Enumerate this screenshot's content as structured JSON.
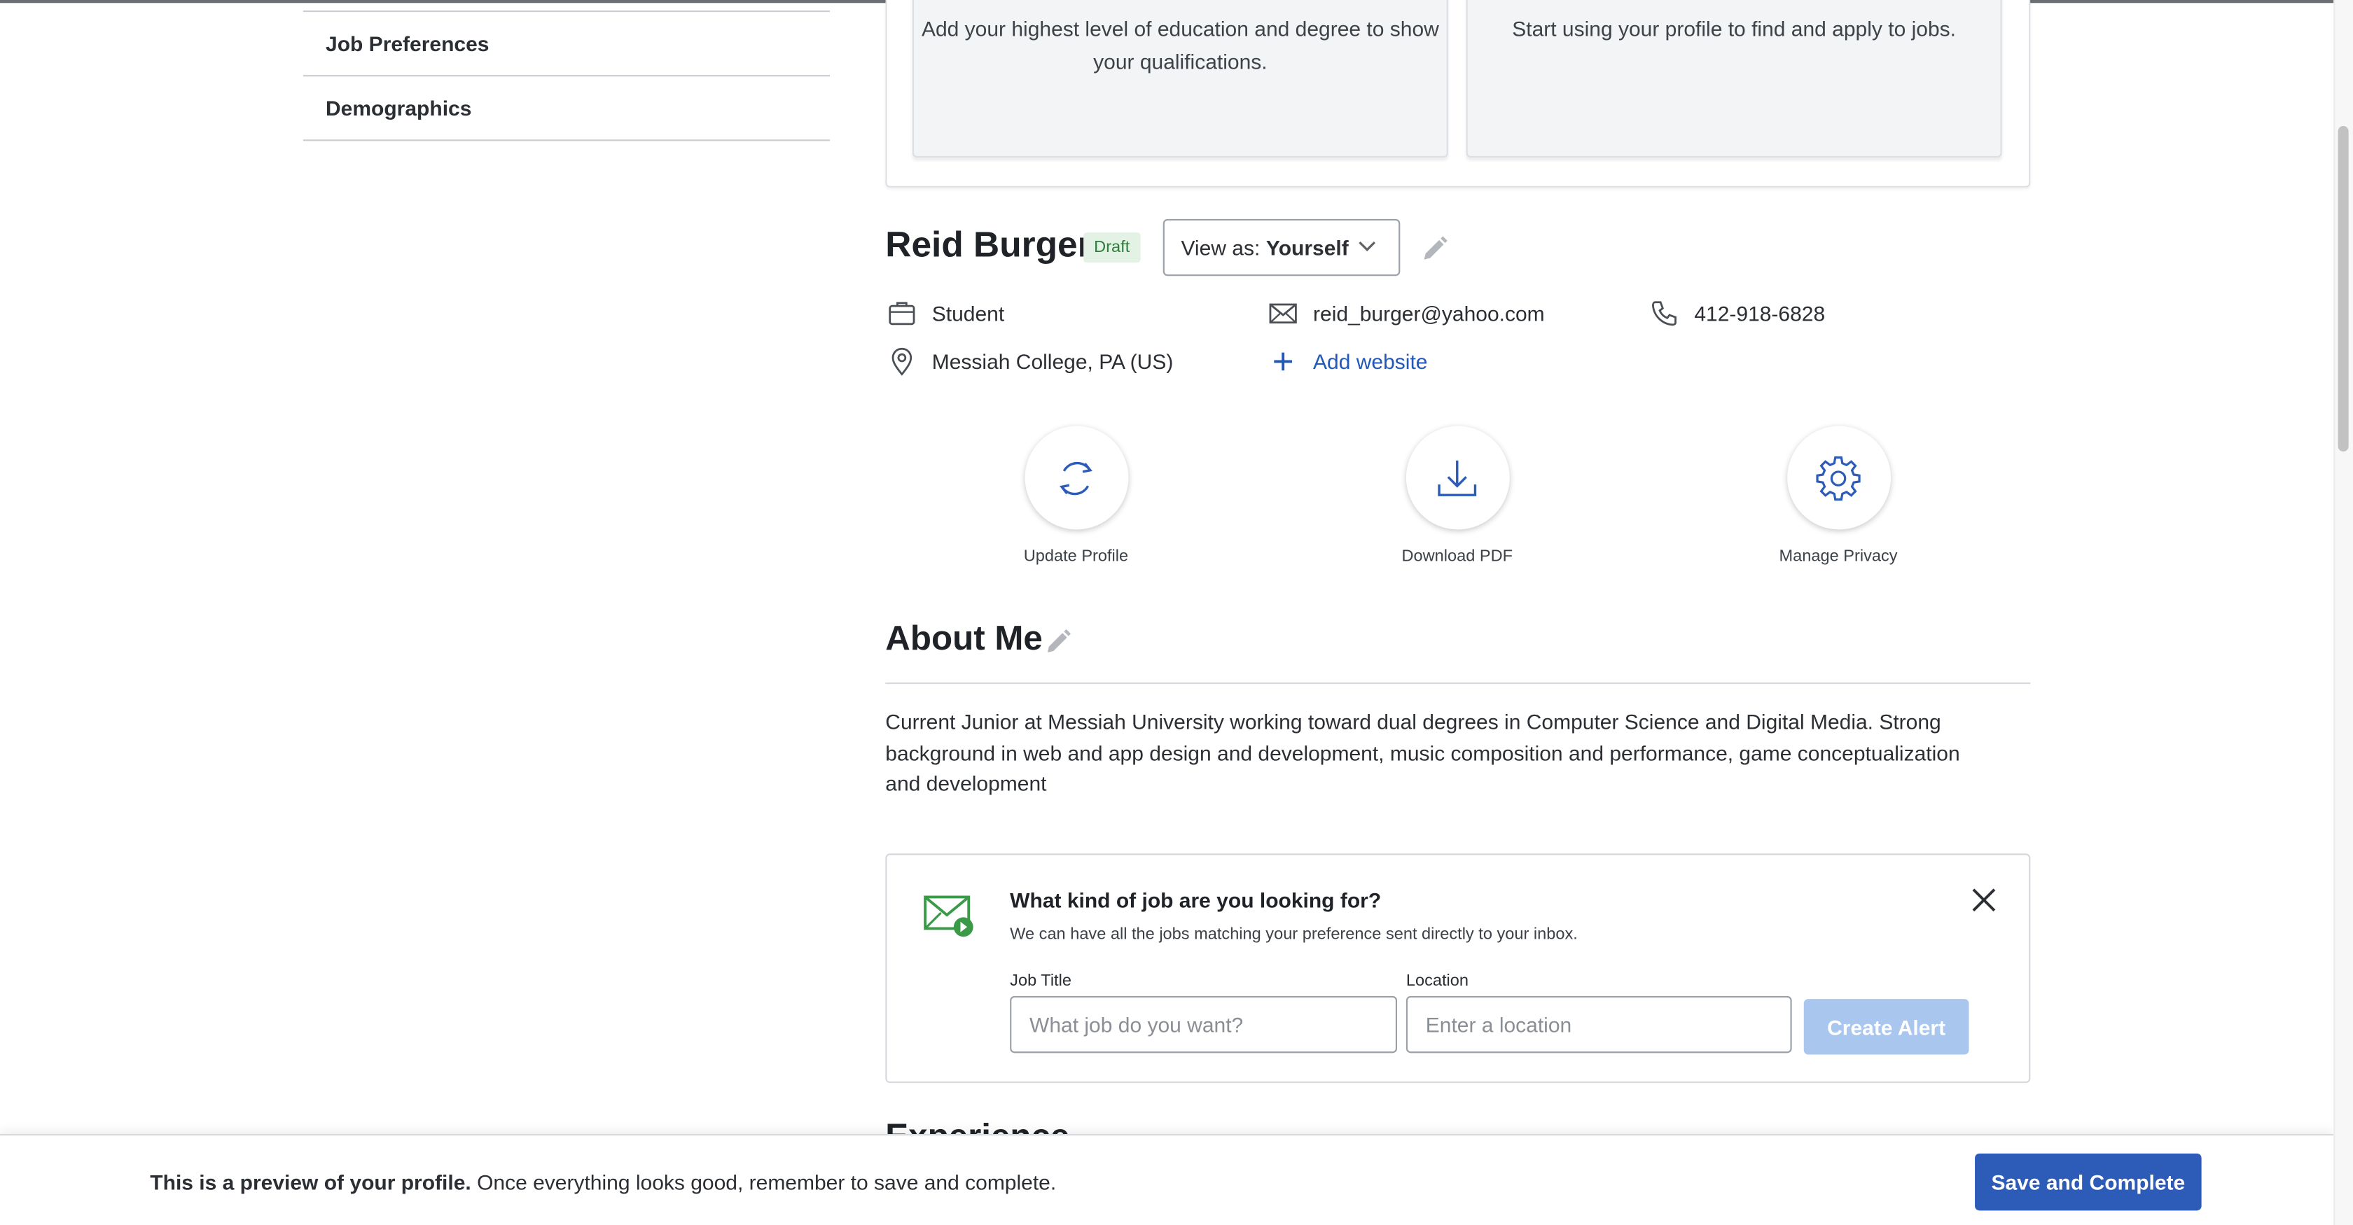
{
  "sidebar": {
    "items": [
      {
        "label": "Job Preferences"
      },
      {
        "label": "Demographics"
      }
    ]
  },
  "cards": {
    "education_text": "Add your highest level of education and degree to show your qualifications.",
    "start_text": "Start using your profile to find and apply to jobs."
  },
  "profile": {
    "name": "Reid Burger",
    "status_badge": "Draft",
    "view_as_prefix": "View as:",
    "view_as_value": "Yourself",
    "role": "Student",
    "email": "reid_burger@yahoo.com",
    "phone": "412-918-6828",
    "location": "Messiah College, PA (US)",
    "add_website": "Add website"
  },
  "actions": [
    {
      "label": "Update Profile",
      "icon": "refresh-icon"
    },
    {
      "label": "Download PDF",
      "icon": "download-icon"
    },
    {
      "label": "Manage Privacy",
      "icon": "gear-icon"
    }
  ],
  "about": {
    "title": "About Me",
    "text": "Current Junior at Messiah University working toward dual degrees in Computer Science and Digital Media. Strong background in web and app design and development, music composition and performance, game conceptualization and development"
  },
  "job_alert": {
    "title": "What kind of job are you looking for?",
    "subtitle": "We can have all the jobs matching your preference sent directly to your inbox.",
    "job_title_label": "Job Title",
    "job_title_placeholder": "What job do you want?",
    "location_label": "Location",
    "location_placeholder": "Enter a location",
    "create_button": "Create Alert"
  },
  "next_section": {
    "title": "Experience"
  },
  "footer": {
    "bold_text": "This is a preview of your profile.",
    "text": " Once everything looks good, remember to save and complete.",
    "save_button": "Save and Complete"
  },
  "colors": {
    "accent": "#2c5cb8",
    "link": "#2258b8",
    "draft_bg": "#e3f2e5",
    "draft_text": "#2e7d3a",
    "disabled_button": "#a9c6ef"
  }
}
